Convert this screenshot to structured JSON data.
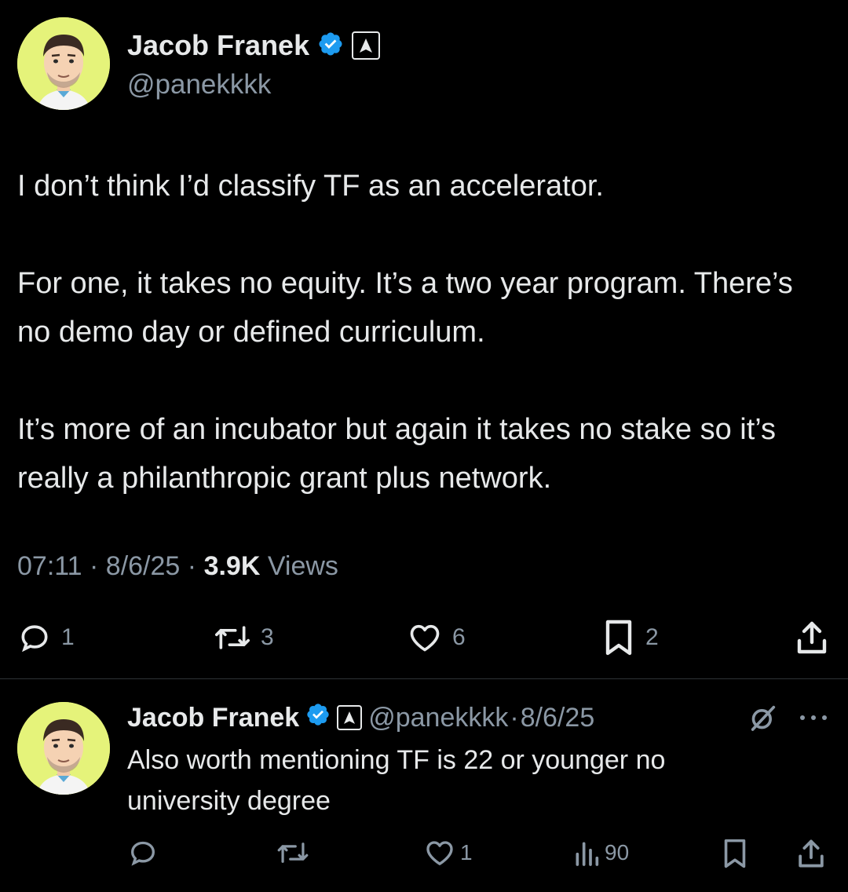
{
  "main_tweet": {
    "author": {
      "name": "Jacob Franek",
      "handle": "@panekkkk"
    },
    "text": "I don’t think I’d classify TF as an accelerator.\n\nFor one, it takes no equity. It’s a two year program. There’s no demo day or defined curriculum.\n\nIt’s more of an incubator but again it takes no stake so it’s really a philanthropic grant plus network.",
    "time": "07:11",
    "date": "8/6/25",
    "views_count": "3.9K",
    "views_label": "Views",
    "actions": {
      "replies": "1",
      "reposts": "3",
      "likes": "6",
      "bookmarks": "2"
    }
  },
  "reply_tweet": {
    "author": {
      "name": "Jacob Franek",
      "handle": "@panekkkk"
    },
    "date": "8/6/25",
    "text": "Also worth mentioning TF is 22 or younger no\nuniversity degree",
    "actions": {
      "replies": "",
      "reposts": "",
      "likes": "1",
      "views": "90"
    }
  },
  "separator": "·",
  "colors": {
    "background": "#000000",
    "text": "#e7e9ea",
    "muted": "#8b98a5",
    "verified": "#1d9bf0",
    "avatar_bg": "#e5f37a"
  },
  "icons": [
    "verified-badge-icon",
    "affiliate-icon",
    "reply-icon",
    "repost-icon",
    "like-icon",
    "bookmark-icon",
    "share-icon",
    "views-icon",
    "grok-icon",
    "more-icon"
  ]
}
